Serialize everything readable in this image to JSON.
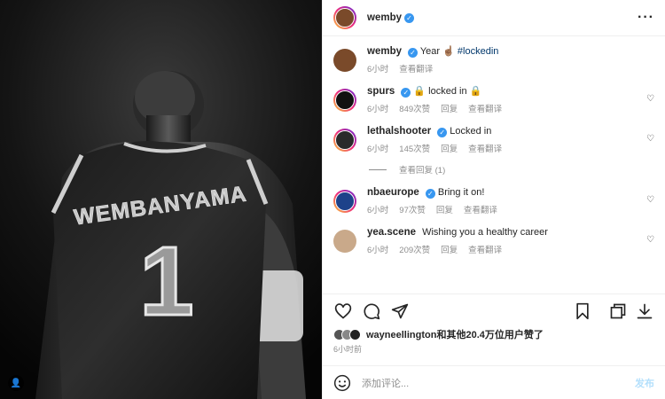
{
  "post": {
    "author": "wemby",
    "jersey_name": "WEMBANYAMA",
    "jersey_number": "1"
  },
  "header": {
    "username": "wemby",
    "verified": true,
    "more_icon": "more-options-icon"
  },
  "caption": {
    "username": "wemby",
    "text": "Year ☝🏽 ",
    "hashtag": "#lockedin",
    "time": "6小时",
    "translate": "查看翻译"
  },
  "comments": [
    {
      "username": "spurs",
      "text": "🔒 locked in 🔒",
      "time": "6小时",
      "likes": "849次赞",
      "reply": "回复",
      "translate": "查看翻译"
    },
    {
      "username": "lethalshooter",
      "text": "Locked in",
      "time": "6小时",
      "likes": "145次赞",
      "reply": "回复",
      "translate": "查看翻译",
      "view_replies": "查看回复 (1)"
    },
    {
      "username": "nbaeurope",
      "text": "Bring it on!",
      "time": "6小时",
      "likes": "97次赞",
      "reply": "回复",
      "translate": "查看翻译"
    },
    {
      "username": "yea.scene",
      "text": "Wishing you a healthy career",
      "time": "6小时",
      "likes": "209次赞",
      "reply": "回复",
      "translate": "查看翻译"
    }
  ],
  "likes_line": {
    "text": "wayneellington和其他20.4万位用户赞了"
  },
  "post_time": "6小时前",
  "add_comment": {
    "placeholder": "添加评论...",
    "post_label": "发布"
  },
  "colors": {
    "verified": "#3897f0",
    "hashtag": "#00376b",
    "post_disabled": "#b2dffc"
  }
}
